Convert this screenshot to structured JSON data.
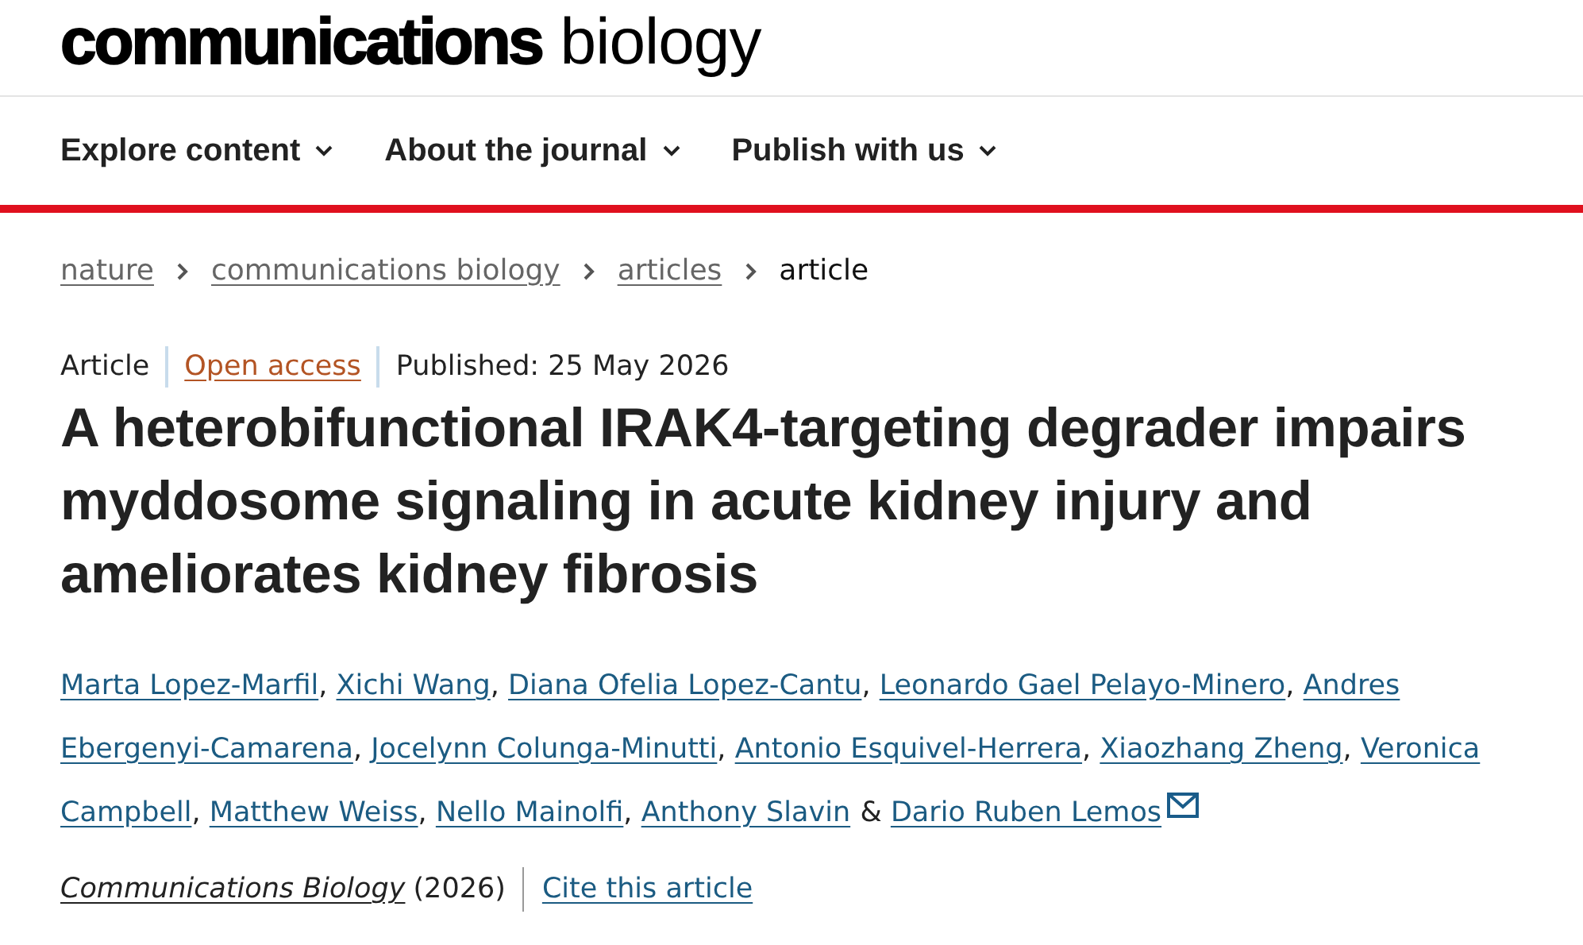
{
  "logo": {
    "bold_part": "communications",
    "light_part": "biology"
  },
  "nav": [
    {
      "label": "Explore content"
    },
    {
      "label": "About the journal"
    },
    {
      "label": "Publish with us"
    }
  ],
  "breadcrumbs": [
    {
      "label": "nature",
      "kind": "link"
    },
    {
      "label": "communications biology",
      "kind": "link"
    },
    {
      "label": "articles",
      "kind": "link"
    },
    {
      "label": "article",
      "kind": "current"
    }
  ],
  "meta": {
    "type": "Article",
    "access": "Open access",
    "published": "Published: 25 May 2026"
  },
  "title": "A heterobifunctional IRAK4-targeting degrader impairs myddosome signaling in acute kidney injury and ameliorates kidney fibrosis",
  "authors": [
    {
      "name": "Marta Lopez-Marfil",
      "separator": ",",
      "corresponding": false
    },
    {
      "name": "Xichi Wang",
      "separator": ",",
      "corresponding": false
    },
    {
      "name": "Diana Ofelia Lopez-Cantu",
      "separator": ",",
      "corresponding": false
    },
    {
      "name": "Leonardo Gael Pelayo-Minero",
      "separator": ",",
      "corresponding": false
    },
    {
      "name_lines": [
        "Andres",
        "Ebergenyi-Camarena"
      ],
      "separator": ",",
      "corresponding": false
    },
    {
      "name": "Jocelynn Colunga-Minutti",
      "separator": ",",
      "corresponding": false
    },
    {
      "name": "Antonio Esquivel-Herrera",
      "separator": ",",
      "corresponding": false
    },
    {
      "name": "Xiaozhang Zheng",
      "separator": ",",
      "corresponding": false
    },
    {
      "name_lines": [
        "Veronica",
        "Campbell"
      ],
      "separator": ",",
      "corresponding": false
    },
    {
      "name": "Matthew Weiss",
      "separator": ",",
      "corresponding": false
    },
    {
      "name": "Nello Mainolfi",
      "separator": ",",
      "corresponding": false
    },
    {
      "name": "Anthony Slavin",
      "separator": "&",
      "corresponding": false
    },
    {
      "name": "Dario Ruben Lemos",
      "corresponding": true
    }
  ],
  "citation": {
    "journal": "Communications Biology",
    "year": "(2026)",
    "cite_link": "Cite this article"
  }
}
